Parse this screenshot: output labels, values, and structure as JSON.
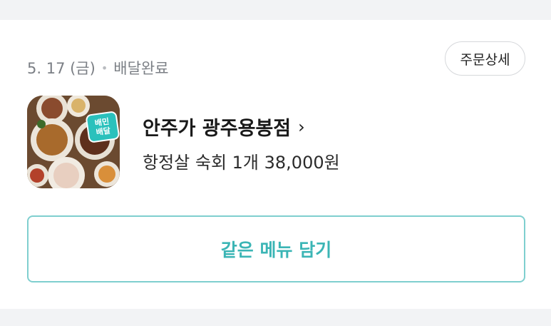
{
  "order": {
    "date": "5. 17 (금)",
    "separator": "•",
    "status": "배달완료",
    "detail_button": "주문상세",
    "store_name": "안주가 광주용봉점",
    "store_chevron": "›",
    "summary": "항정살 숙회 1개 38,000원",
    "reorder_button": "같은 메뉴 담기",
    "badge_text_line1": "배민",
    "badge_text_line2": "배달"
  },
  "colors": {
    "accent": "#3bb5b5",
    "accent_border": "#7fcfcf",
    "muted_text": "#7b7f85",
    "background": "#f2f3f5"
  }
}
